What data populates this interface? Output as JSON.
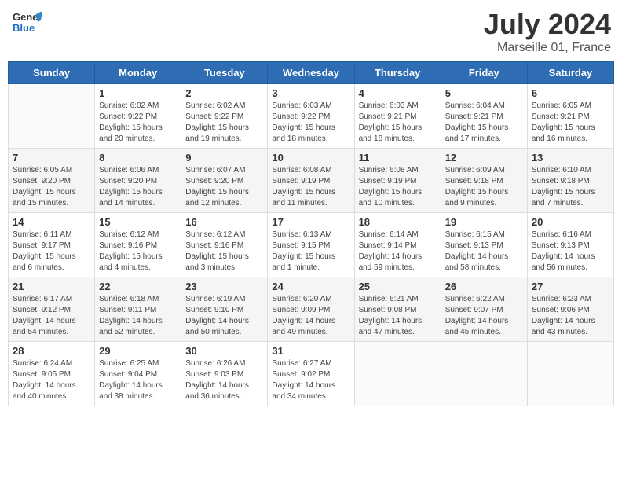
{
  "header": {
    "logo_general": "General",
    "logo_blue": "Blue",
    "month_year": "July 2024",
    "location": "Marseille 01, France"
  },
  "days_of_week": [
    "Sunday",
    "Monday",
    "Tuesday",
    "Wednesday",
    "Thursday",
    "Friday",
    "Saturday"
  ],
  "weeks": [
    [
      {
        "day": "",
        "info": ""
      },
      {
        "day": "1",
        "info": "Sunrise: 6:02 AM\nSunset: 9:22 PM\nDaylight: 15 hours\nand 20 minutes."
      },
      {
        "day": "2",
        "info": "Sunrise: 6:02 AM\nSunset: 9:22 PM\nDaylight: 15 hours\nand 19 minutes."
      },
      {
        "day": "3",
        "info": "Sunrise: 6:03 AM\nSunset: 9:22 PM\nDaylight: 15 hours\nand 18 minutes."
      },
      {
        "day": "4",
        "info": "Sunrise: 6:03 AM\nSunset: 9:21 PM\nDaylight: 15 hours\nand 18 minutes."
      },
      {
        "day": "5",
        "info": "Sunrise: 6:04 AM\nSunset: 9:21 PM\nDaylight: 15 hours\nand 17 minutes."
      },
      {
        "day": "6",
        "info": "Sunrise: 6:05 AM\nSunset: 9:21 PM\nDaylight: 15 hours\nand 16 minutes."
      }
    ],
    [
      {
        "day": "7",
        "info": "Sunrise: 6:05 AM\nSunset: 9:20 PM\nDaylight: 15 hours\nand 15 minutes."
      },
      {
        "day": "8",
        "info": "Sunrise: 6:06 AM\nSunset: 9:20 PM\nDaylight: 15 hours\nand 14 minutes."
      },
      {
        "day": "9",
        "info": "Sunrise: 6:07 AM\nSunset: 9:20 PM\nDaylight: 15 hours\nand 12 minutes."
      },
      {
        "day": "10",
        "info": "Sunrise: 6:08 AM\nSunset: 9:19 PM\nDaylight: 15 hours\nand 11 minutes."
      },
      {
        "day": "11",
        "info": "Sunrise: 6:08 AM\nSunset: 9:19 PM\nDaylight: 15 hours\nand 10 minutes."
      },
      {
        "day": "12",
        "info": "Sunrise: 6:09 AM\nSunset: 9:18 PM\nDaylight: 15 hours\nand 9 minutes."
      },
      {
        "day": "13",
        "info": "Sunrise: 6:10 AM\nSunset: 9:18 PM\nDaylight: 15 hours\nand 7 minutes."
      }
    ],
    [
      {
        "day": "14",
        "info": "Sunrise: 6:11 AM\nSunset: 9:17 PM\nDaylight: 15 hours\nand 6 minutes."
      },
      {
        "day": "15",
        "info": "Sunrise: 6:12 AM\nSunset: 9:16 PM\nDaylight: 15 hours\nand 4 minutes."
      },
      {
        "day": "16",
        "info": "Sunrise: 6:12 AM\nSunset: 9:16 PM\nDaylight: 15 hours\nand 3 minutes."
      },
      {
        "day": "17",
        "info": "Sunrise: 6:13 AM\nSunset: 9:15 PM\nDaylight: 15 hours\nand 1 minute."
      },
      {
        "day": "18",
        "info": "Sunrise: 6:14 AM\nSunset: 9:14 PM\nDaylight: 14 hours\nand 59 minutes."
      },
      {
        "day": "19",
        "info": "Sunrise: 6:15 AM\nSunset: 9:13 PM\nDaylight: 14 hours\nand 58 minutes."
      },
      {
        "day": "20",
        "info": "Sunrise: 6:16 AM\nSunset: 9:13 PM\nDaylight: 14 hours\nand 56 minutes."
      }
    ],
    [
      {
        "day": "21",
        "info": "Sunrise: 6:17 AM\nSunset: 9:12 PM\nDaylight: 14 hours\nand 54 minutes."
      },
      {
        "day": "22",
        "info": "Sunrise: 6:18 AM\nSunset: 9:11 PM\nDaylight: 14 hours\nand 52 minutes."
      },
      {
        "day": "23",
        "info": "Sunrise: 6:19 AM\nSunset: 9:10 PM\nDaylight: 14 hours\nand 50 minutes."
      },
      {
        "day": "24",
        "info": "Sunrise: 6:20 AM\nSunset: 9:09 PM\nDaylight: 14 hours\nand 49 minutes."
      },
      {
        "day": "25",
        "info": "Sunrise: 6:21 AM\nSunset: 9:08 PM\nDaylight: 14 hours\nand 47 minutes."
      },
      {
        "day": "26",
        "info": "Sunrise: 6:22 AM\nSunset: 9:07 PM\nDaylight: 14 hours\nand 45 minutes."
      },
      {
        "day": "27",
        "info": "Sunrise: 6:23 AM\nSunset: 9:06 PM\nDaylight: 14 hours\nand 43 minutes."
      }
    ],
    [
      {
        "day": "28",
        "info": "Sunrise: 6:24 AM\nSunset: 9:05 PM\nDaylight: 14 hours\nand 40 minutes."
      },
      {
        "day": "29",
        "info": "Sunrise: 6:25 AM\nSunset: 9:04 PM\nDaylight: 14 hours\nand 38 minutes."
      },
      {
        "day": "30",
        "info": "Sunrise: 6:26 AM\nSunset: 9:03 PM\nDaylight: 14 hours\nand 36 minutes."
      },
      {
        "day": "31",
        "info": "Sunrise: 6:27 AM\nSunset: 9:02 PM\nDaylight: 14 hours\nand 34 minutes."
      },
      {
        "day": "",
        "info": ""
      },
      {
        "day": "",
        "info": ""
      },
      {
        "day": "",
        "info": ""
      }
    ]
  ]
}
